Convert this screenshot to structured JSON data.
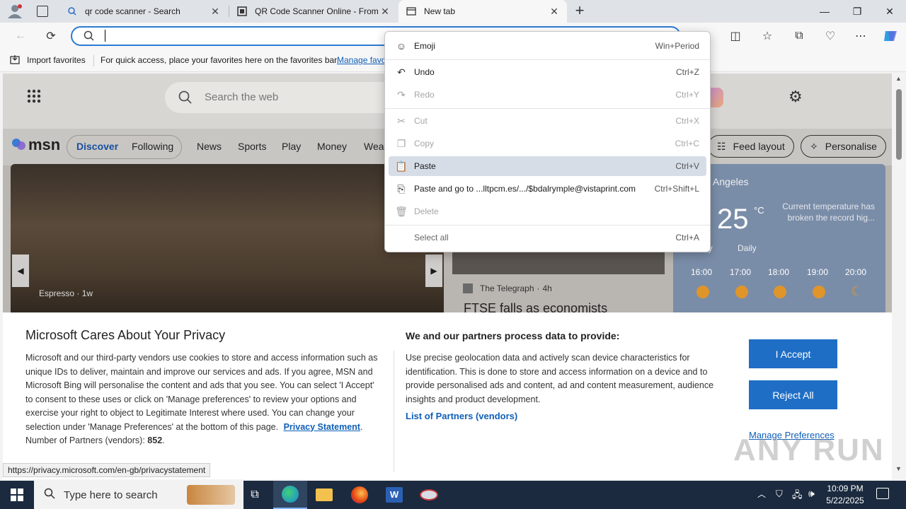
{
  "tabs": [
    {
      "title": "qr code scanner - Search"
    },
    {
      "title": "QR Code Scanner Online - From"
    },
    {
      "title": "New tab"
    }
  ],
  "favorites_bar": {
    "import_label": "Import favorites",
    "hint": "For quick access, place your favorites here on the favorites bar.",
    "manage_link": "Manage favo"
  },
  "msn": {
    "search_placeholder": "Search the web",
    "logo": "msn",
    "nav": [
      "Discover",
      "Following",
      "News",
      "Sports",
      "Play",
      "Money",
      "Wea"
    ],
    "feed_layout": "Feed layout",
    "personalise": "Personalise",
    "hero_source": "Espresso",
    "hero_time": "1w",
    "news2_source": "The Telegraph",
    "news2_time": "4h",
    "news2_headline": "FTSE falls as economists",
    "weather_location": "os Angeles",
    "weather_temp": "25",
    "weather_unit": "°C",
    "weather_note": "Current temperature has broken the record hig...",
    "weather_tabs": [
      "ly",
      "Daily"
    ],
    "weather_hours": [
      "16:00",
      "17:00",
      "18:00",
      "19:00",
      "20:00"
    ]
  },
  "context_menu": {
    "items": [
      {
        "label": "Emoji",
        "shortcut": "Win+Period",
        "icon": "emoji-icon",
        "disabled": false
      },
      {
        "label": "Undo",
        "shortcut": "Ctrl+Z",
        "icon": "undo-icon",
        "disabled": false
      },
      {
        "label": "Redo",
        "shortcut": "Ctrl+Y",
        "icon": "redo-icon",
        "disabled": true
      },
      {
        "label": "Cut",
        "shortcut": "Ctrl+X",
        "icon": "cut-icon",
        "disabled": true
      },
      {
        "label": "Copy",
        "shortcut": "Ctrl+C",
        "icon": "copy-icon",
        "disabled": true
      },
      {
        "label": "Paste",
        "shortcut": "Ctrl+V",
        "icon": "paste-icon",
        "disabled": false
      },
      {
        "label": "Paste and go to ...lltpcm.es/.../$bdalrymple@vistaprint.com",
        "shortcut": "Ctrl+Shift+L",
        "icon": "paste-go-icon",
        "disabled": false
      },
      {
        "label": "Delete",
        "shortcut": "",
        "icon": "delete-icon",
        "disabled": true
      },
      {
        "label": "Select all",
        "shortcut": "Ctrl+A",
        "icon": "",
        "disabled": false
      }
    ]
  },
  "privacy": {
    "title": "Microsoft Cares About Your Privacy",
    "body": "Microsoft and our third-party vendors use cookies to store and access information such as unique IDs to deliver, maintain and improve our services and ads. If you agree, MSN and Microsoft Bing will personalise the content and ads that you see. You can select 'I Accept' to consent to these uses or click on 'Manage preferences' to review your options and exercise your right to object to Legitimate Interest where used.  You can change your selection under 'Manage Preferences' at the bottom of this page.",
    "privacy_link": "Privacy Statement",
    "partners_label": "Number of Partners (vendors):",
    "partners_count": "852",
    "right_title": "We and our partners process data to provide:",
    "right_body": "Use precise geolocation data and actively scan device characteristics for identification. This is done to store and access information on a device and to provide personalised ads and content, ad and content measurement, audience insights and product development.",
    "partners_link": "List of Partners (vendors)",
    "accept": "I Accept",
    "reject": "Reject All",
    "manage": "Manage Preferences"
  },
  "status_url": "https://privacy.microsoft.com/en-gb/privacystatement",
  "taskbar": {
    "search_placeholder": "Type here to search",
    "time": "10:09 PM",
    "date": "5/22/2025"
  },
  "watermark": "ANY RUN"
}
